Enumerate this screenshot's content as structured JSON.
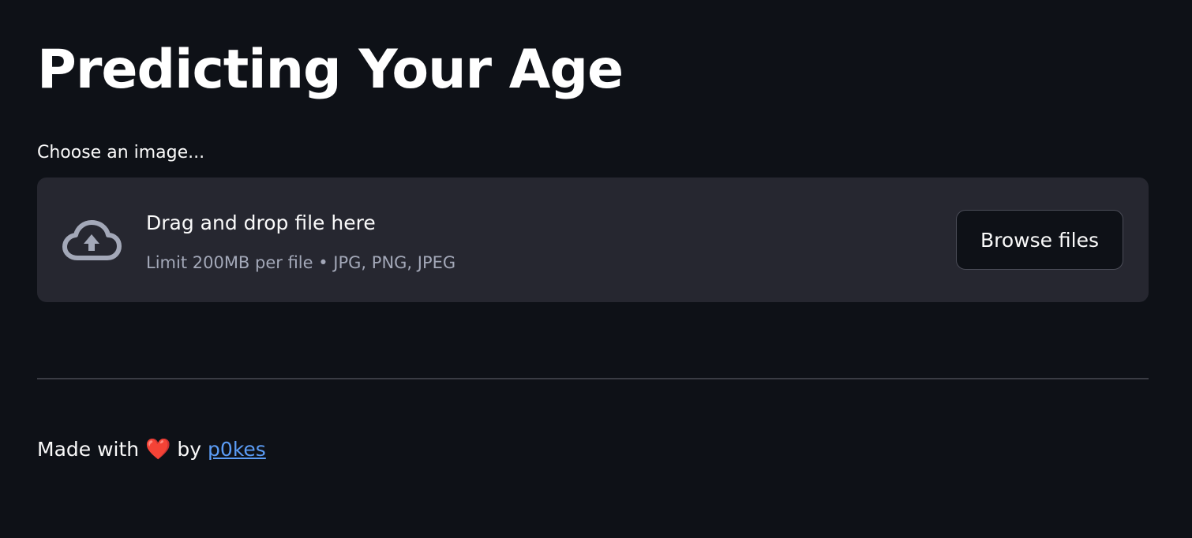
{
  "page": {
    "title": "Predicting Your Age"
  },
  "uploader": {
    "label": "Choose an image...",
    "dropzone_title": "Drag and drop file here",
    "dropzone_subtitle": "Limit 200MB per file • JPG, PNG, JPEG",
    "browse_label": "Browse files",
    "icon": "cloud-upload-icon"
  },
  "footer": {
    "prefix": "Made with",
    "heart": "❤️",
    "by": "by",
    "author": "p0kes"
  },
  "colors": {
    "background": "#0e1117",
    "dropzone": "#262730",
    "link": "#5b9cf5",
    "heart": "#e0282e"
  }
}
